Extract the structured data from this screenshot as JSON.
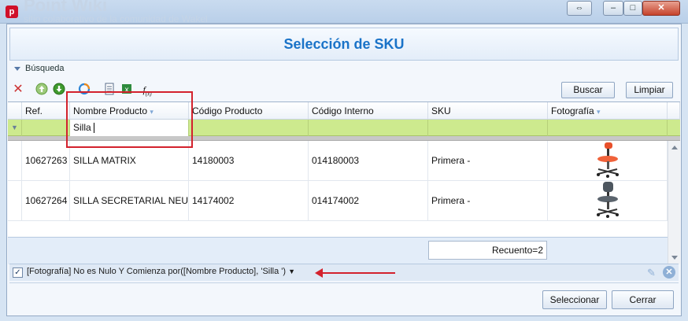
{
  "window": {
    "app_icon_label": "p",
    "bg_text_1": "Point Wiki",
    "bg_text_2": "sitio colaborativo de la comunidad de Wakel"
  },
  "header": {
    "title": "Selección de SKU"
  },
  "search": {
    "section_label": "Búsqueda",
    "buscar_label": "Buscar",
    "limpiar_label": "Limpiar"
  },
  "grid": {
    "columns": [
      "Ref.",
      "Nombre Producto",
      "Código Producto",
      "Código Interno",
      "SKU",
      "Fotografía"
    ],
    "filter_value": "Silla",
    "rows": [
      {
        "ref": "10627263",
        "nombre": "SILLA MATRIX",
        "codigo_producto": "14180003",
        "codigo_interno": "014180003",
        "sku": "Primera -",
        "foto": "orange-office-chair"
      },
      {
        "ref": "10627264",
        "nombre": "SILLA SECRETARIAL NEU...",
        "codigo_producto": "14174002",
        "codigo_interno": "014174002",
        "sku": "Primera -",
        "foto": "gray-office-chair"
      }
    ],
    "count_label": "Recuento=2"
  },
  "filter_bar": {
    "checked": true,
    "text": "[Fotografía] No es Nulo Y Comienza por([Nombre Producto], 'Silla ')"
  },
  "actions": {
    "seleccionar_label": "Seleccionar",
    "cerrar_label": "Cerrar"
  },
  "colors": {
    "accent_title": "#1a73c8",
    "filter_row": "#cdea8e",
    "annotation": "#d3222d"
  }
}
